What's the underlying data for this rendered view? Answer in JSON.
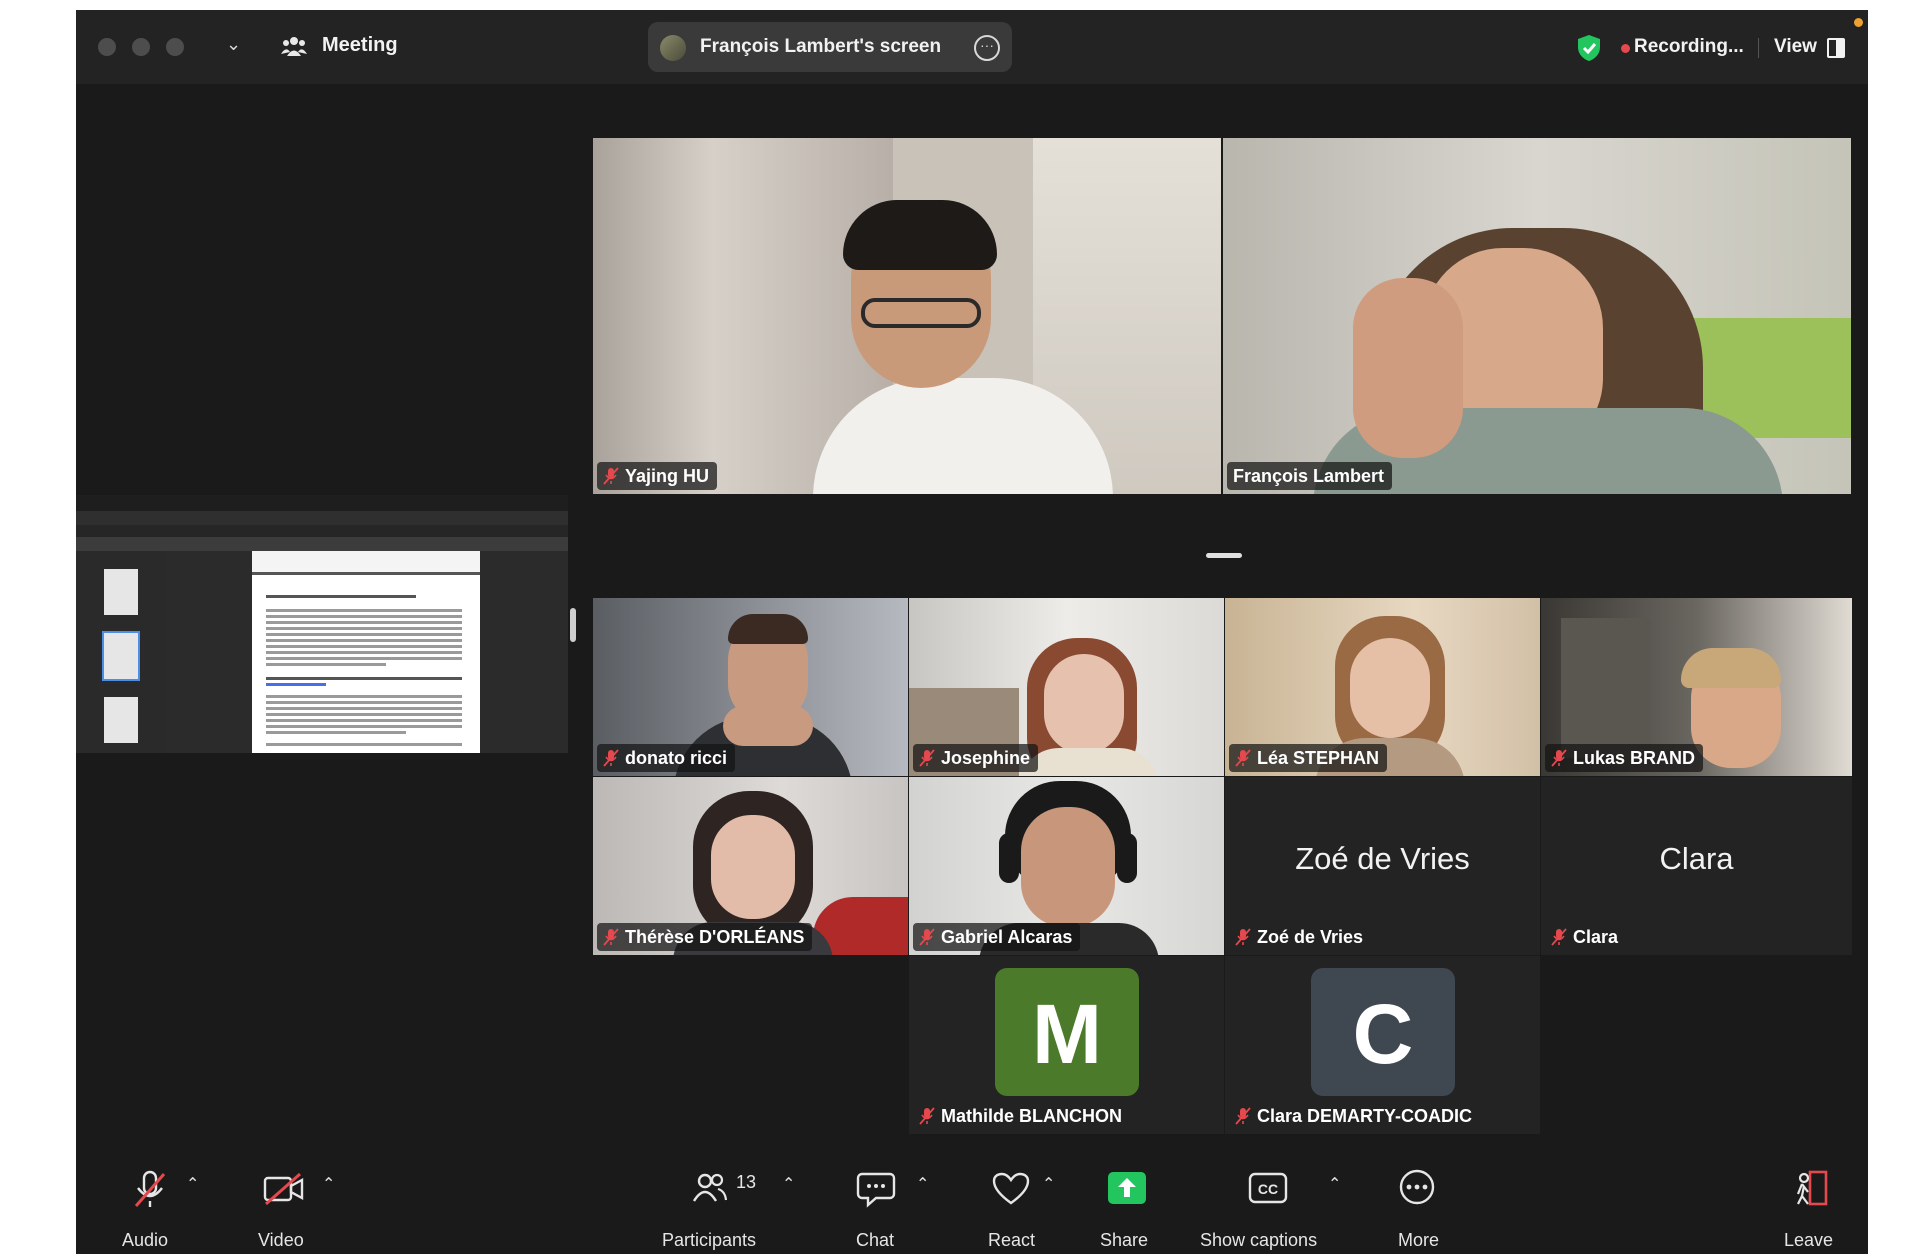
{
  "titlebar": {
    "meeting_label": "Meeting",
    "share_label": "François Lambert's screen",
    "recording_label": "Recording...",
    "view_label": "View"
  },
  "tiles_top": [
    {
      "name": "Yajing HU",
      "muted": true
    },
    {
      "name": "François Lambert",
      "muted": false,
      "active_speaker": true
    }
  ],
  "tiles_grid": [
    {
      "name": "donato ricci",
      "muted": true
    },
    {
      "name": "Josephine",
      "muted": true
    },
    {
      "name": "Léa STEPHAN",
      "muted": true
    },
    {
      "name": "Lukas BRAND",
      "muted": true
    },
    {
      "name": "Thérèse D'ORLÉANS",
      "muted": true
    },
    {
      "name": "Gabriel Alcaras",
      "muted": true
    },
    {
      "name": "Zoé de Vries",
      "display": "Zoé de Vries",
      "video_off": true,
      "muted": true
    },
    {
      "name": "Clara",
      "display": "Clara",
      "video_off": true,
      "muted": true
    }
  ],
  "tiles_avatar": [
    {
      "name": "Mathilde BLANCHON",
      "initial": "M",
      "color": "#4a7a2a",
      "muted": true
    },
    {
      "name": "Clara DEMARTY-COADIC",
      "initial": "C",
      "color": "#3f4850",
      "muted": true
    }
  ],
  "toolbar": {
    "audio": "Audio",
    "video": "Video",
    "participants": "Participants",
    "participant_count": "13",
    "chat": "Chat",
    "react": "React",
    "share": "Share",
    "captions": "Show captions",
    "more": "More",
    "leave": "Leave"
  },
  "colors": {
    "active_speaker": "#4cce4a",
    "share_green": "#22c55e",
    "recording_red": "#e5484d",
    "leave_red": "#e5484d"
  }
}
